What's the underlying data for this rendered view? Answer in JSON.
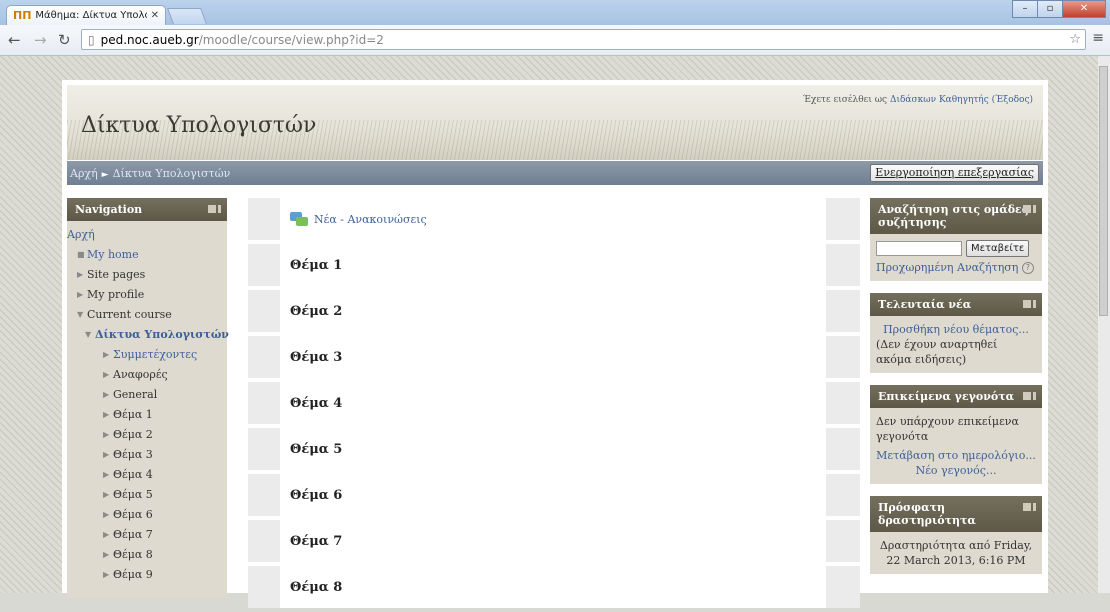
{
  "browser": {
    "tab_title": "Μάθημα: Δίκτυα Υπολογι",
    "tab_favicon": "moodle-favicon",
    "url_host": "ped.noc.aueb.gr",
    "url_path": "/moodle/course/view.php?id=2"
  },
  "header": {
    "site_title": "Δίκτυα Υπολογιστών",
    "login_prefix": "Έχετε εισέλθει ως",
    "login_user": "Διδάσκων Καθηγητής",
    "logout_label": "(Έξοδος)"
  },
  "navbar": {
    "home": "Αρχή",
    "separator": "►",
    "course": "Δίκτυα Υπολογιστών",
    "edit_button": "Ενεργοποίηση επεξεργασίας"
  },
  "navigation": {
    "title": "Navigation",
    "items": [
      {
        "label": "Αρχή",
        "style": "link",
        "level": 0,
        "marker": ""
      },
      {
        "label": "My home",
        "style": "link",
        "level": 1,
        "marker": "■"
      },
      {
        "label": "Site pages",
        "style": "plain",
        "level": 1,
        "marker": "▶"
      },
      {
        "label": "My profile",
        "style": "plain",
        "level": 1,
        "marker": "▶"
      },
      {
        "label": "Current course",
        "style": "plain",
        "level": 1,
        "marker": "▼"
      },
      {
        "label": "Δίκτυα Υπολογιστών",
        "style": "bold-link",
        "level": 2,
        "marker": "▼"
      },
      {
        "label": "Συμμετέχοντες",
        "style": "link",
        "level": 3,
        "marker": "▶"
      },
      {
        "label": "Αναφορές",
        "style": "plain",
        "level": 3,
        "marker": "▶"
      },
      {
        "label": "General",
        "style": "plain",
        "level": 3,
        "marker": "▶"
      },
      {
        "label": "Θέμα 1",
        "style": "plain",
        "level": 3,
        "marker": "▶"
      },
      {
        "label": "Θέμα 2",
        "style": "plain",
        "level": 3,
        "marker": "▶"
      },
      {
        "label": "Θέμα 3",
        "style": "plain",
        "level": 3,
        "marker": "▶"
      },
      {
        "label": "Θέμα 4",
        "style": "plain",
        "level": 3,
        "marker": "▶"
      },
      {
        "label": "Θέμα 5",
        "style": "plain",
        "level": 3,
        "marker": "▶"
      },
      {
        "label": "Θέμα 6",
        "style": "plain",
        "level": 3,
        "marker": "▶"
      },
      {
        "label": "Θέμα 7",
        "style": "plain",
        "level": 3,
        "marker": "▶"
      },
      {
        "label": "Θέμα 8",
        "style": "plain",
        "level": 3,
        "marker": "▶"
      },
      {
        "label": "Θέμα 9",
        "style": "plain",
        "level": 3,
        "marker": "▶"
      }
    ]
  },
  "course": {
    "news_forum": "Νέα - Ανακοινώσεις",
    "topics": [
      "Θέμα 1",
      "Θέμα 2",
      "Θέμα 3",
      "Θέμα 4",
      "Θέμα 5",
      "Θέμα 6",
      "Θέμα 7",
      "Θέμα 8"
    ]
  },
  "blocks": {
    "search": {
      "title": "Αναζήτηση στις ομάδες συζήτησης",
      "button": "Μεταβείτε",
      "advanced": "Προχωρημένη Αναζήτηση"
    },
    "news": {
      "title": "Τελευταία νέα",
      "add_link": "Προσθήκη νέου θέματος...",
      "empty": "(Δεν έχουν αναρτηθεί ακόμα ειδήσεις)"
    },
    "upcoming": {
      "title": "Επικείμενα γεγονότα",
      "empty": "Δεν υπάρχουν επικείμενα γεγονότα",
      "calendar_link": "Μετάβαση στο ημερολόγιο...",
      "new_event": "Νέο γεγονός..."
    },
    "recent": {
      "title": "Πρόσφατη δραστηριότητα",
      "text": "Δραστηριότητα από Friday, 22 March 2013, 6:16 PM"
    }
  }
}
